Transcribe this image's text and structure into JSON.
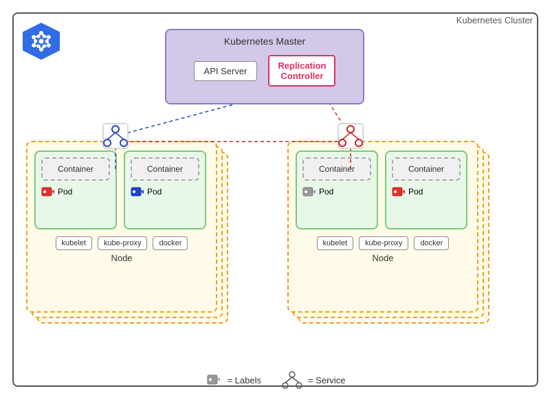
{
  "cluster": {
    "label": "Kubernetes Cluster"
  },
  "master": {
    "title": "Kubernetes Master",
    "api_server": "API Server",
    "replication_controller": "Replication\nController"
  },
  "left_node": {
    "pod1": {
      "container_label": "Container",
      "pod_label": "Pod",
      "tag_color": "#e0302a"
    },
    "pod2": {
      "container_label": "Container",
      "pod_label": "Pod",
      "tag_color": "#2255cc"
    },
    "services": [
      "kubelet",
      "kube-proxy",
      "docker"
    ],
    "label": "Node"
  },
  "right_node": {
    "pod1": {
      "container_label": "Container",
      "pod_label": "Pod",
      "tag_color": "#888888"
    },
    "pod2": {
      "container_label": "Container",
      "pod_label": "Pod",
      "tag_color": "#e0302a"
    },
    "services": [
      "kubelet",
      "kube-proxy",
      "docker"
    ],
    "label": "Node"
  },
  "legend": {
    "labels_text": "= Labels",
    "service_text": "= Service"
  },
  "icons": {
    "k8s_wheel": "⎈",
    "tag": "🏷",
    "tree": "⑂"
  }
}
